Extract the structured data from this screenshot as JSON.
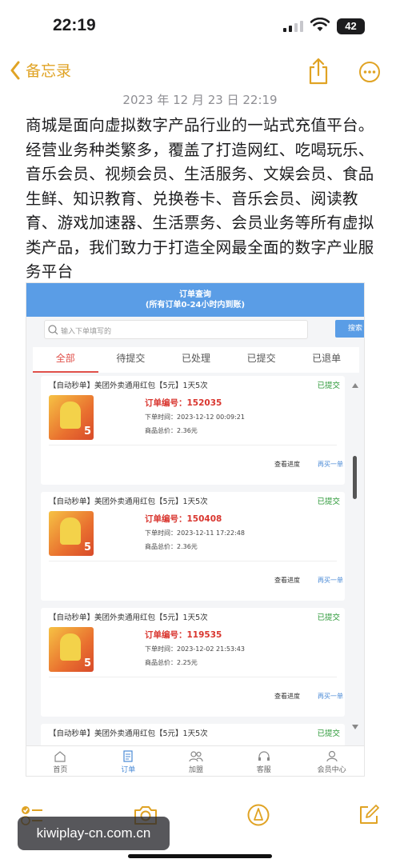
{
  "status": {
    "time": "22:19",
    "battery": "42"
  },
  "nav": {
    "back_label": "备忘录"
  },
  "note": {
    "date": "2023 年 12 月 23 日 22:19",
    "body": "商城是面向虚拟数字产品行业的一站式充值平台。经营业务种类繁多，覆盖了打造网红、吃喝玩乐、音乐会员、视频会员、生活服务、文娱会员、食品生鲜、知识教育、兑换卷卡、音乐会员、阅读教育、游戏加速器、生活票务、会员业务等所有虚拟类产品，我们致力于打造全网最全面的数字产业服务平台"
  },
  "shot": {
    "header_title": "订单查询",
    "header_sub": "(所有订单0-24小时内到账)",
    "search_placeholder": "输入下单填写的",
    "search_button": "搜索",
    "tabs": [
      "全部",
      "待提交",
      "已处理",
      "已提交",
      "已退单"
    ],
    "orders": [
      {
        "title": "【自动秒单】美团外卖通用红包【5元】1天5次",
        "status": "已提交",
        "order_no": "订单编号：152035",
        "time": "下单时间：2023-12-12 00:09:21",
        "total": "商品总价：2.36元",
        "btn_a": "查看进度",
        "btn_b": "再买一单"
      },
      {
        "title": "【自动秒单】美团外卖通用红包【5元】1天5次",
        "status": "已提交",
        "order_no": "订单编号：150408",
        "time": "下单时间：2023-12-11 17:22:48",
        "total": "商品总价：2.36元",
        "btn_a": "查看进度",
        "btn_b": "再买一单"
      },
      {
        "title": "【自动秒单】美团外卖通用红包【5元】1天5次",
        "status": "已提交",
        "order_no": "订单编号：119535",
        "time": "下单时间：2023-12-02 21:53:43",
        "total": "商品总价：2.25元",
        "btn_a": "查看进度",
        "btn_b": "再买一单"
      },
      {
        "title": "【自动秒单】美团外卖通用红包【5元】1天5次",
        "status": "已提交"
      }
    ],
    "thumb_badge": "5",
    "tabbar": [
      "首页",
      "订单",
      "加盟",
      "客服",
      "会员中心"
    ]
  },
  "watermark": "kiwiplay-cn.com.cn",
  "colors": {
    "accent": "#e0a324",
    "shot_blue": "#5a9de6",
    "order_red": "#d9362f",
    "status_green": "#2e9a3a"
  }
}
